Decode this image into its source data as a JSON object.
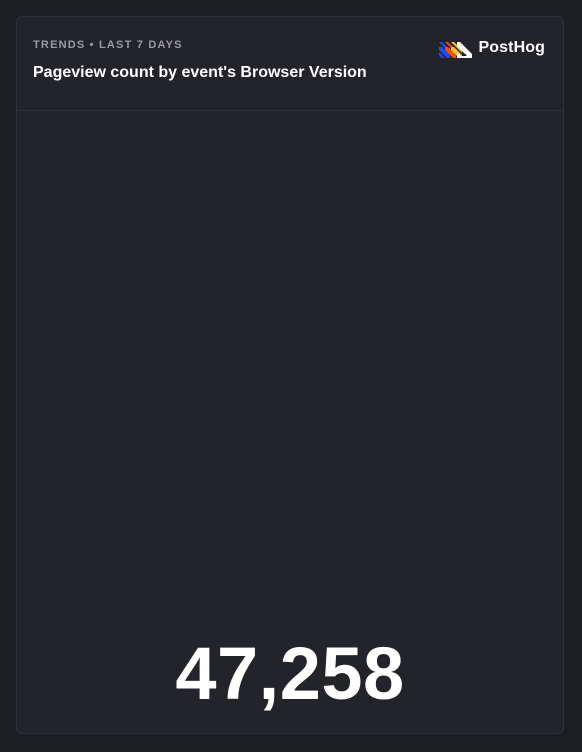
{
  "card": {
    "subtitle": "TRENDS • LAST 7 DAYS",
    "title": "Pageview count by event's Browser Version",
    "brand": {
      "name": "PostHog",
      "logo_icon": "posthog-logo-icon",
      "logo_colors": [
        "#1d4aff",
        "#f54e00",
        "#f9bd2b",
        "#ffffff"
      ]
    },
    "value": "47,258"
  },
  "colors": {
    "page_background": "#1d1e22",
    "card_background": "#232429",
    "border": "#2f3036",
    "text_primary": "#ffffff",
    "text_muted": "#9a9ba0"
  }
}
